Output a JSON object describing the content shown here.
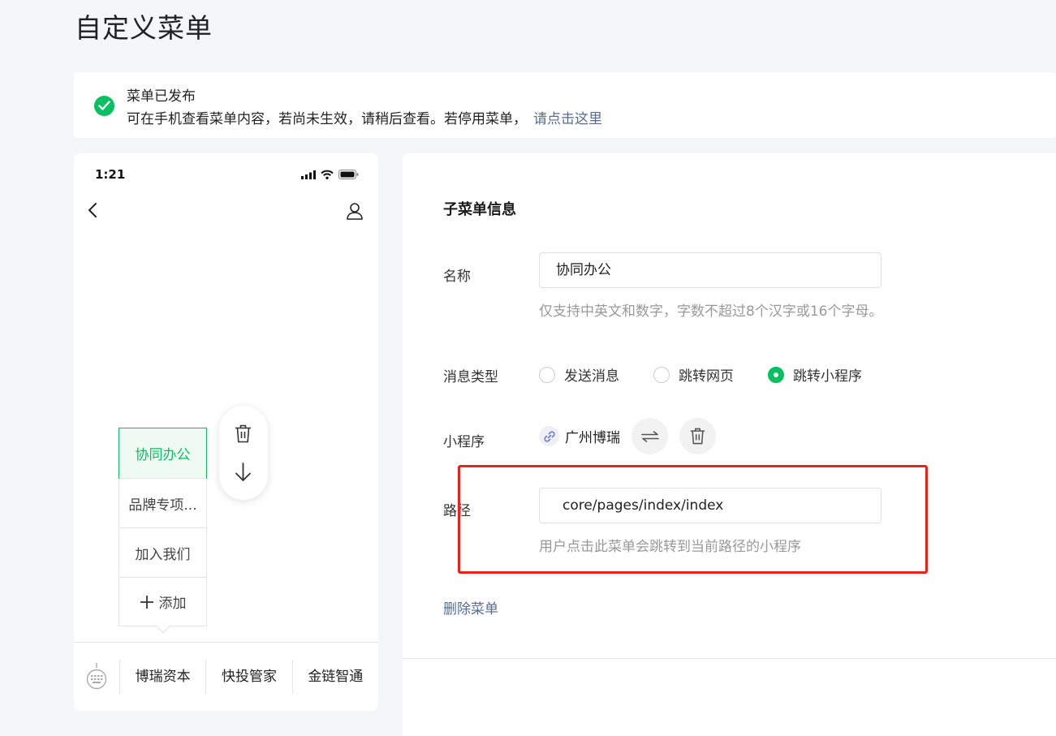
{
  "page": {
    "title": "自定义菜单"
  },
  "notice": {
    "title": "菜单已发布",
    "description": "可在手机查看菜单内容，若尚未生效，请稍后查看。若停用菜单，",
    "link": "请点击这里",
    "accent_color": "#07c160",
    "icon": "check-circle-icon"
  },
  "phone": {
    "time": "1:21",
    "submenu": {
      "items": [
        {
          "label": "协同办公",
          "active": true
        },
        {
          "label": "品牌专项..."
        },
        {
          "label": "加入我们"
        }
      ],
      "add_label": "添加"
    },
    "bottom_menu": [
      "博瑞资本",
      "快投管家",
      "金链智通"
    ]
  },
  "form": {
    "section_title": "子菜单信息",
    "name": {
      "label": "名称",
      "value": "协同办公",
      "hint": "仅支持中英文和数字，字数不超过8个汉字或16个字母。"
    },
    "message_type": {
      "label": "消息类型",
      "options": [
        "发送消息",
        "跳转网页",
        "跳转小程序"
      ],
      "selected": "跳转小程序"
    },
    "miniprogram": {
      "label": "小程序",
      "name": "广州博瑞"
    },
    "path": {
      "label": "路径",
      "value": "core/pages/index/index",
      "hint": "用户点击此菜单会跳转到当前路径的小程序"
    },
    "delete_label": "删除菜单"
  },
  "colors": {
    "brand_green": "#07c160",
    "link_blue": "#576b95",
    "highlight_red": "#e8231b"
  }
}
